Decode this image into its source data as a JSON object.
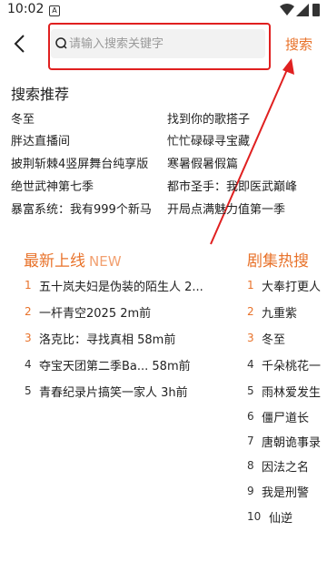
{
  "status": {
    "time": "10:02",
    "notif_glyph": "A"
  },
  "header": {
    "search_placeholder": "请输入搜索关键字",
    "search_button": "搜索"
  },
  "recommend": {
    "title": "搜索推荐",
    "items": [
      "冬至",
      "找到你的歌搭子",
      "胖达直播间",
      "忙忙碌碌寻宝藏",
      "披荆斩棘4竖屏舞台纯享版",
      "寒暑假暑假篇",
      "绝世武神第七季",
      "都市圣手：我即医武巅峰",
      "暴富系统：我有999个新马",
      "开局点满魅力值第一季"
    ]
  },
  "latest": {
    "title": "最新上线",
    "tag": "NEW",
    "items": [
      {
        "rank": "1",
        "text": "五十岚夫妇是伪装的陌生人 2..."
      },
      {
        "rank": "2",
        "text": "一杆青空2025 2m前"
      },
      {
        "rank": "3",
        "text": "洛克比：寻找真相 58m前"
      },
      {
        "rank": "4",
        "text": "夺宝天团第二季Ba... 58m前"
      },
      {
        "rank": "5",
        "text": "青春纪录片搞笑一家人 3h前"
      }
    ]
  },
  "hot": {
    "title": "剧集热搜",
    "items": [
      {
        "rank": "1",
        "text": "大奉打更人"
      },
      {
        "rank": "2",
        "text": "九重紫"
      },
      {
        "rank": "3",
        "text": "冬至"
      },
      {
        "rank": "4",
        "text": "千朵桃花一"
      },
      {
        "rank": "5",
        "text": "雨林爱发生"
      },
      {
        "rank": "6",
        "text": "僵尸道长"
      },
      {
        "rank": "7",
        "text": "唐朝诡事录"
      },
      {
        "rank": "8",
        "text": "因法之名"
      },
      {
        "rank": "9",
        "text": "我是刑警"
      },
      {
        "rank": "10",
        "text": "仙逆"
      }
    ]
  },
  "colors": {
    "accent": "#e8722a",
    "highlight": "#e02020"
  }
}
